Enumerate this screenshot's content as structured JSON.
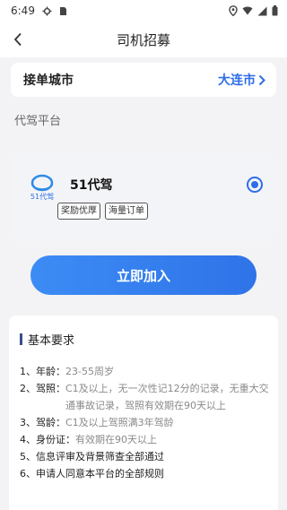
{
  "status": {
    "time": "6:49"
  },
  "nav": {
    "title": "司机招募"
  },
  "city": {
    "label": "接单城市",
    "value": "大连市"
  },
  "platform_section": {
    "title": "代驾平台"
  },
  "platform": {
    "logo_text": "51代驾",
    "name": "51代驾",
    "tags": [
      "奖励优厚",
      "海量订单"
    ],
    "selected": true
  },
  "join_button": {
    "label": "立即加入"
  },
  "requirements": {
    "title": "基本要求",
    "items": [
      {
        "label": "1、年龄：",
        "value": "23-55周岁"
      },
      {
        "label": "2、驾照：",
        "value": "C1及以上，无一次性记12分的记录，无重大交通事故记录，驾照有效期在90天以上"
      },
      {
        "label": "3、驾龄：",
        "value": "C1及以上驾照满3年驾龄"
      },
      {
        "label": "4、身份证：",
        "value": "有效期在90天以上"
      },
      {
        "label": "",
        "value": "5、信息评审及背景筛查全部通过"
      },
      {
        "label": "",
        "value": "6、申请人同意本平台的全部规则"
      }
    ]
  },
  "colors": {
    "accent": "#2e6ee6",
    "page_bg": "#f3f3f5",
    "card_bg": "#ffffff"
  }
}
